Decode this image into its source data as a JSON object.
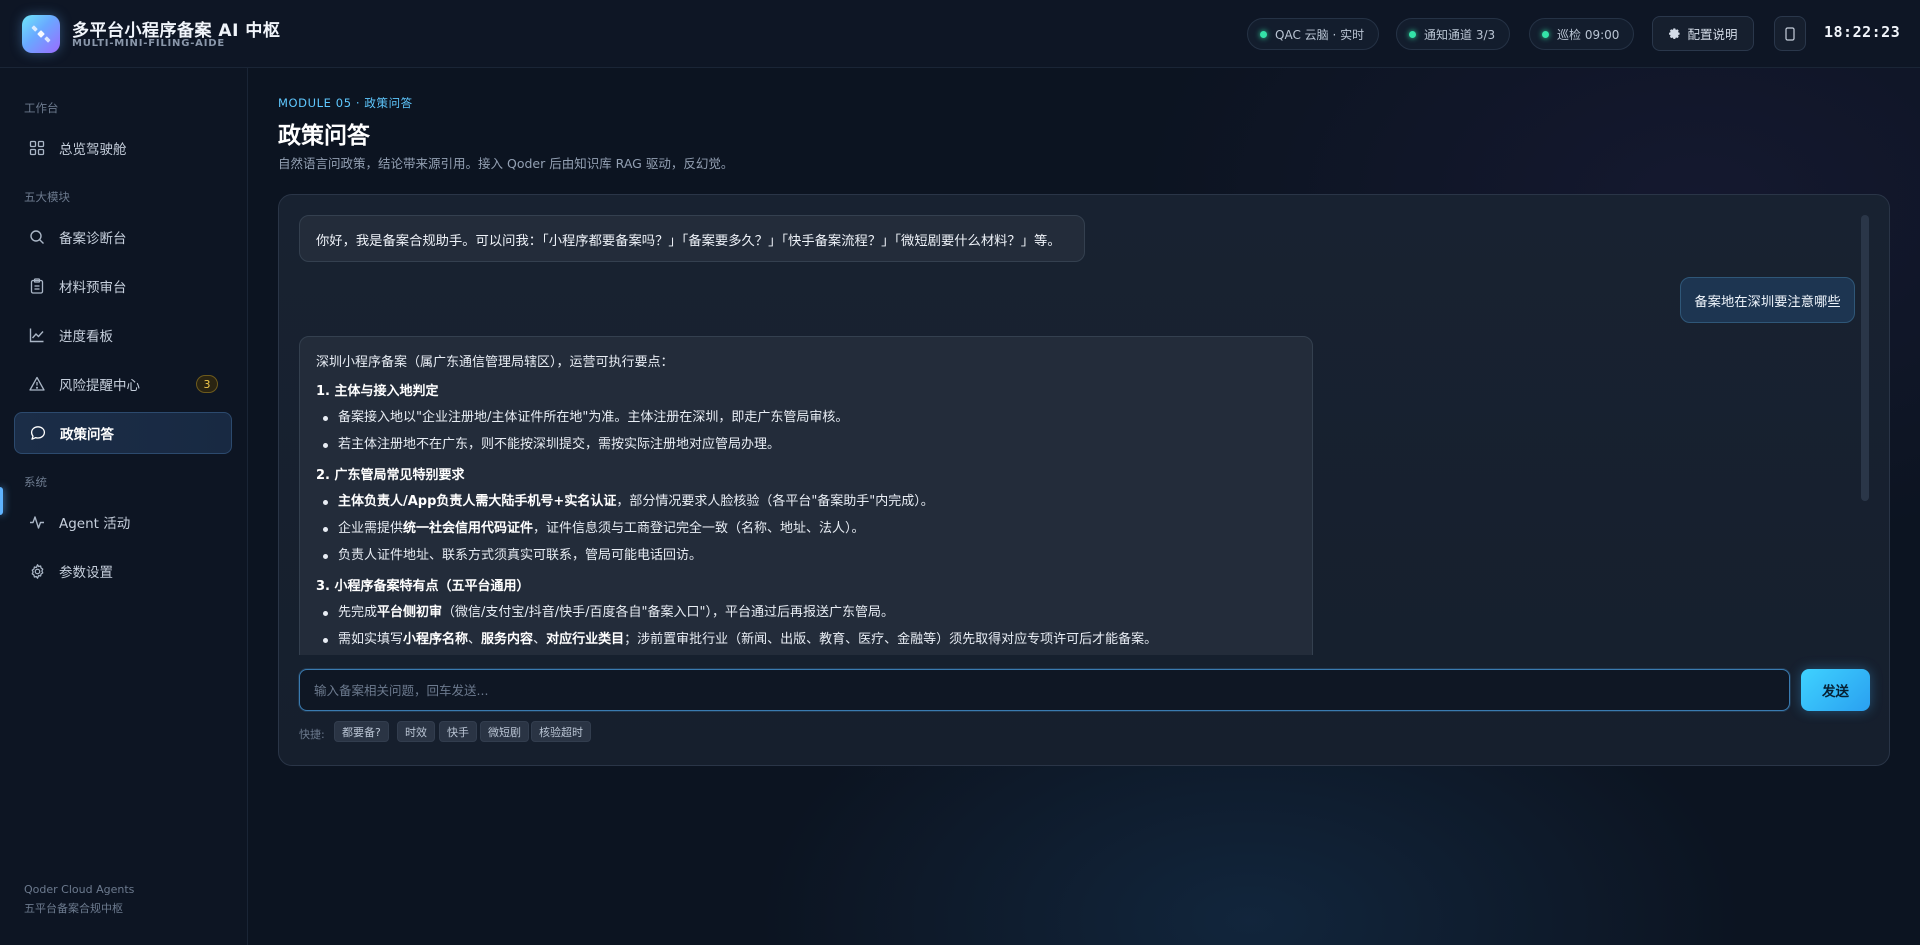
{
  "header": {
    "title": "多平台小程序备案 AI 中枢",
    "subtitle": "MULTI-MINI-FILING-AIDE",
    "status": [
      {
        "label": "QAC 云脑 · 实时"
      },
      {
        "label": "通知通道 3/3"
      },
      {
        "label": "巡检 09:00"
      }
    ],
    "config_label": "配置说明",
    "clock": "18:22:23"
  },
  "sidebar": {
    "section_workbench": "工作台",
    "dashboard": "总览驾驶舱",
    "section_modules": "五大模块",
    "diagnosis": "备案诊断台",
    "materials": "材料预审台",
    "progress": "进度看板",
    "risk": "风险提醒中心",
    "risk_badge": "3",
    "policy_qa": "政策问答",
    "section_system": "系统",
    "agent": "Agent 活动",
    "settings": "参数设置",
    "footer_line1": "Qoder Cloud Agents",
    "footer_line2": "五平台备案合规中枢"
  },
  "main": {
    "module_tag": "MODULE 05 · 政策问答",
    "title": "政策问答",
    "subtitle": "自然语言问政策，结论带来源引用。接入 Qoder 后由知识库 RAG 驱动，反幻觉。"
  },
  "chat": {
    "greeting": "你好，我是备案合规助手。可以问我：「小程序都要备案吗？」「备案要多久？」「快手备案流程？」「微短剧要什么材料？」等。",
    "user_question": "备案地在深圳要注意哪些",
    "answer": {
      "intro": "深圳小程序备案（属广东通信管理局辖区），运营可执行要点：",
      "s1_title": "1. 主体与接入地判定",
      "s1_i1": "备案接入地以\"企业注册地/主体证件所在地\"为准。主体注册在深圳，即走广东管局审核。",
      "s1_i2": "若主体注册地不在广东，则不能按深圳提交，需按实际注册地对应管局办理。",
      "s2_title": "2. 广东管局常见特别要求",
      "s2_i1_bold": "主体负责人/App负责人需大陆手机号+实名认证",
      "s2_i1_rest": "，部分情况要求人脸核验（各平台\"备案助手\"内完成）。",
      "s2_i2_pre": "企业需提供",
      "s2_i2_bold": "统一社会信用代码证件",
      "s2_i2_rest": "，证件信息须与工商登记完全一致（名称、地址、法人）。",
      "s2_i3": "负责人证件地址、联系方式须真实可联系，管局可能电话回访。",
      "s3_title": "3. 小程序备案特有点（五平台通用）",
      "s3_i1_pre": "先完成",
      "s3_i1_bold": "平台侧初审",
      "s3_i1_rest": "（微信/支付宝/抖音/快手/百度各自\"备案入口\"），平台通过后再报送广东管局。",
      "s3_i2_pre": "需如实填写",
      "s3_i2_b1": "小程序名称",
      "s3_i2_sep1": "、",
      "s3_i2_b2": "服务内容",
      "s3_i2_sep2": "、",
      "s3_i2_b3": "对应行业类目",
      "s3_i2_rest": "；涉前置审批行业（新闻、出版、教育、医疗、金融等）须先取得对应专项许可后才能备案。"
    },
    "input_placeholder": "输入备案相关问题，回车发送...",
    "send_label": "发送",
    "quick_label": "快捷:",
    "quick": [
      "都要备?",
      "时效",
      "快手",
      "微短剧",
      "核验超时"
    ]
  }
}
